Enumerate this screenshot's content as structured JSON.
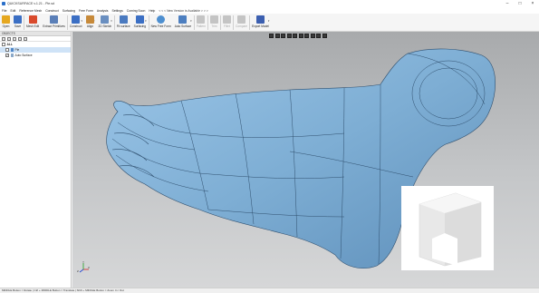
{
  "window": {
    "title": "QUICKSURFACE v.1.21 - Pie.sd",
    "controls": [
      "–",
      "□",
      "×"
    ]
  },
  "menu": {
    "items": [
      "File",
      "Edit",
      "Reference Mesh",
      "Construct",
      "Surfacing",
      "Free Form",
      "Analysis",
      "Settings",
      "Coming Soon",
      "Help"
    ],
    "notice": "< < < New Version is Available > > >"
  },
  "toolbar": {
    "tools": [
      {
        "label": "Open",
        "icon": "open-folder-icon",
        "color": "#e6a820",
        "enabled": true
      },
      {
        "label": "Save",
        "icon": "save-disk-icon",
        "color": "#3b6fc4",
        "enabled": true
      },
      {
        "label": "Mesh Edit",
        "icon": "mesh-edit-icon",
        "color": "#d94a2c",
        "enabled": true
      },
      {
        "label": "Extract Primitives",
        "icon": "extract-primitives-icon",
        "color": "#5a7fb8",
        "enabled": true
      },
      {
        "label": "Construct",
        "icon": "construct-icon",
        "color": "#3b6fc4",
        "enabled": true
      },
      {
        "label": "Align",
        "icon": "align-icon",
        "color": "#c78a3a",
        "enabled": true
      },
      {
        "label": "2D Sketch",
        "icon": "sketch-icon",
        "color": "#6a8fc0",
        "enabled": true
      },
      {
        "label": "Fit surface",
        "icon": "fit-surface-icon",
        "color": "#4a7ac0",
        "enabled": true
      },
      {
        "label": "Surfacing",
        "icon": "surfacing-icon",
        "color": "#3b6fc4",
        "enabled": true
      },
      {
        "label": "New Free Form",
        "icon": "free-form-icon",
        "color": "#4d8fd0",
        "enabled": true
      },
      {
        "label": "Auto Surface",
        "icon": "auto-surface-icon",
        "color": "#4d7fc0",
        "enabled": true
      },
      {
        "label": "Pattern",
        "icon": "pattern-icon",
        "color": "#b8b8b8",
        "enabled": false
      },
      {
        "label": "Trim",
        "icon": "trim-icon",
        "color": "#b8b8b8",
        "enabled": false
      },
      {
        "label": "Fillet",
        "icon": "fillet-icon",
        "color": "#b8b8b8",
        "enabled": false
      },
      {
        "label": "Compare",
        "icon": "compare-icon",
        "color": "#b8b8b8",
        "enabled": false
      },
      {
        "label": "Export Model",
        "icon": "export-model-icon",
        "color": "#3b5fb0",
        "enabled": true
      }
    ]
  },
  "objects_panel": {
    "header": "OBJECTS",
    "tree": [
      {
        "label": "ALL",
        "checked": "",
        "selected": false
      },
      {
        "label": "Pie",
        "checked": "",
        "selected": true
      },
      {
        "label": "Auto Surface",
        "checked": "✓",
        "selected": false
      }
    ]
  },
  "viewport": {
    "background_top": "#a8aaac",
    "model_color": "#7eaed4",
    "axes": {
      "x": "X",
      "y": "Y",
      "z": "Z"
    }
  },
  "status": {
    "text": "MIDDLE Button = Rotate | Ctrl + MIDDLE Button = Translate | Shift + MIDDLE Button = Zoom In / Out"
  }
}
